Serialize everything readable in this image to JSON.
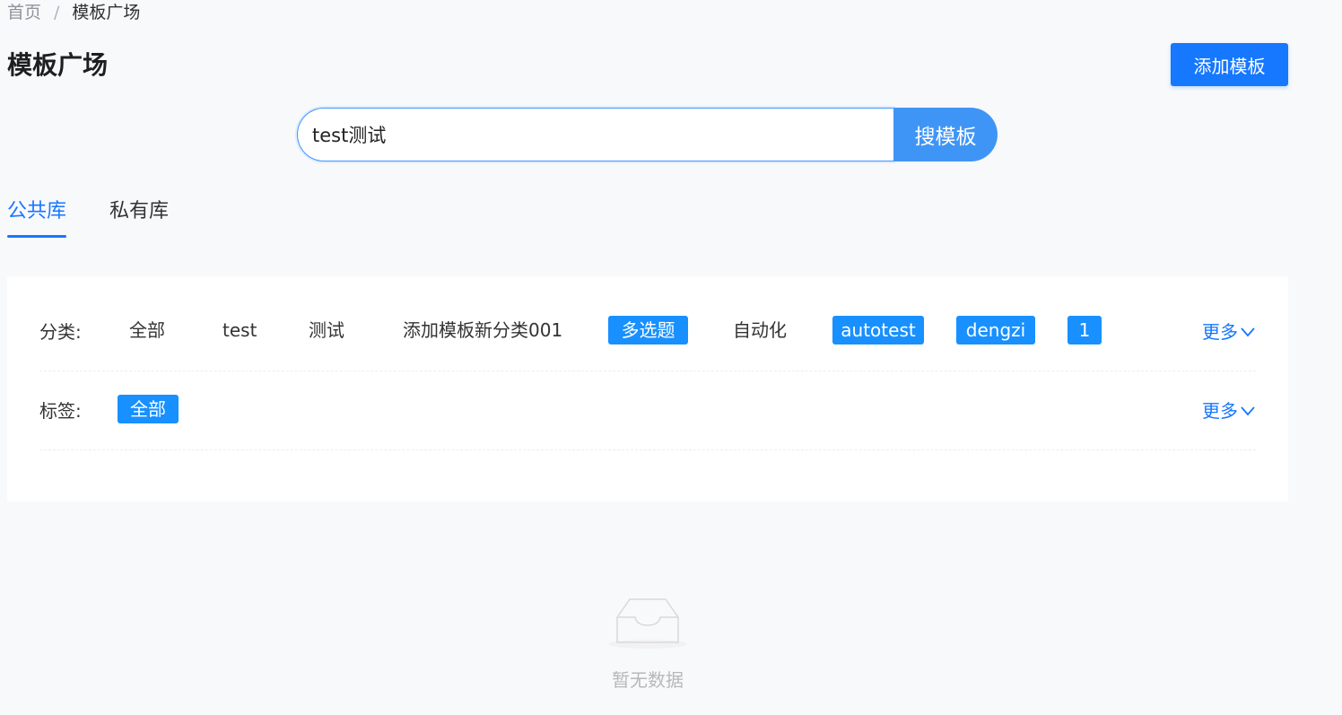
{
  "breadcrumb": {
    "home": "首页",
    "separator": "/",
    "current": "模板广场"
  },
  "page": {
    "title": "模板广场",
    "add_button": "添加模板"
  },
  "search": {
    "value": "test测试",
    "button": "搜模板"
  },
  "tabs": [
    {
      "label": "公共库",
      "active": true
    },
    {
      "label": "私有库",
      "active": false
    }
  ],
  "filters": {
    "category": {
      "label": "分类:",
      "options": [
        {
          "label": "全部",
          "selected": false
        },
        {
          "label": "test",
          "selected": false
        },
        {
          "label": "测试",
          "selected": false
        },
        {
          "label": "添加模板新分类001",
          "selected": false
        },
        {
          "label": "多选题",
          "selected": true
        },
        {
          "label": "自动化",
          "selected": false
        },
        {
          "label": "autotest",
          "selected": true
        },
        {
          "label": "dengzi",
          "selected": true
        },
        {
          "label": "1",
          "selected": true
        }
      ],
      "more": "更多"
    },
    "tag": {
      "label": "标签:",
      "options": [
        {
          "label": "全部",
          "selected": true
        }
      ],
      "more": "更多"
    }
  },
  "empty": {
    "icon": "empty-inbox-icon",
    "text": "暂无数据"
  },
  "colors": {
    "primary": "#1677ff",
    "selected_tag": "#1890ff",
    "search_button": "#3f95f5"
  }
}
